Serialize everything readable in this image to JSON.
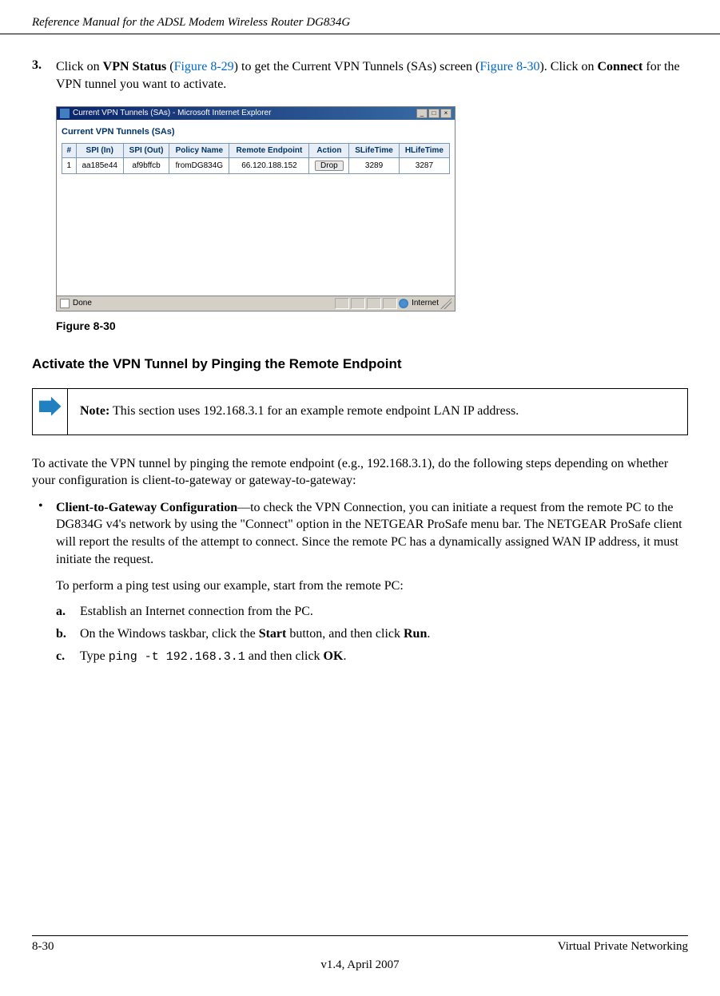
{
  "header": {
    "title": "Reference Manual for the ADSL Modem Wireless Router DG834G"
  },
  "step3": {
    "num": "3.",
    "pre": "Click on ",
    "bold1": "VPN Status",
    "mid1": " (",
    "link1": "Figure 8-29",
    "mid2": ") to get the Current VPN Tunnels (SAs) screen (",
    "link2": "Figure 8-30",
    "mid3": "). Click on ",
    "bold2": "Connect",
    "post": " for the VPN tunnel you want to activate."
  },
  "ie": {
    "title": "Current VPN Tunnels (SAs) - Microsoft Internet Explorer",
    "body_title": "Current VPN Tunnels (SAs)",
    "headers": [
      "#",
      "SPI (In)",
      "SPI (Out)",
      "Policy Name",
      "Remote Endpoint",
      "Action",
      "SLifeTime",
      "HLifeTime"
    ],
    "row": {
      "num": "1",
      "spi_in": "aa185e44",
      "spi_out": "af9bffcb",
      "policy": "fromDG834G",
      "endpoint": "66.120.188.152",
      "action": "Drop",
      "slife": "3289",
      "hlife": "3287"
    },
    "status_done": "Done",
    "status_internet": "Internet"
  },
  "figure_caption": "Figure 8-30",
  "section_heading": "Activate the VPN Tunnel by Pinging the Remote Endpoint",
  "note": {
    "label": "Note:",
    "text": " This section uses 192.168.3.1 for an example remote endpoint LAN IP address."
  },
  "para1": "To activate the VPN tunnel by pinging the remote endpoint (e.g., 192.168.3.1), do the following steps depending on whether your configuration is client-to-gateway or gateway-to-gateway:",
  "bullet1": {
    "bold": "Client-to-Gateway Configuration",
    "text": "—to check the VPN Connection, you can initiate a request from the remote PC to the DG834G v4's network by using the \"Connect\" option in the NETGEAR ProSafe menu bar. The NETGEAR ProSafe client will report the results of the attempt to connect. Since the remote PC has a dynamically assigned WAN IP address, it must initiate the request."
  },
  "para2": "To perform a ping test using our example, start from the remote PC:",
  "substep_a": {
    "num": "a.",
    "text": "Establish an Internet connection from the PC."
  },
  "substep_b": {
    "num": "b.",
    "pre": "On the Windows taskbar, click the ",
    "bold1": "Start",
    "mid": " button, and then click ",
    "bold2": "Run",
    "post": "."
  },
  "substep_c": {
    "num": "c.",
    "pre": "Type ",
    "mono": "ping -t 192.168.3.1",
    "mid": " and then click ",
    "bold": "OK",
    "post": "."
  },
  "footer": {
    "page": "8-30",
    "section": "Virtual Private Networking",
    "version": "v1.4, April 2007"
  }
}
